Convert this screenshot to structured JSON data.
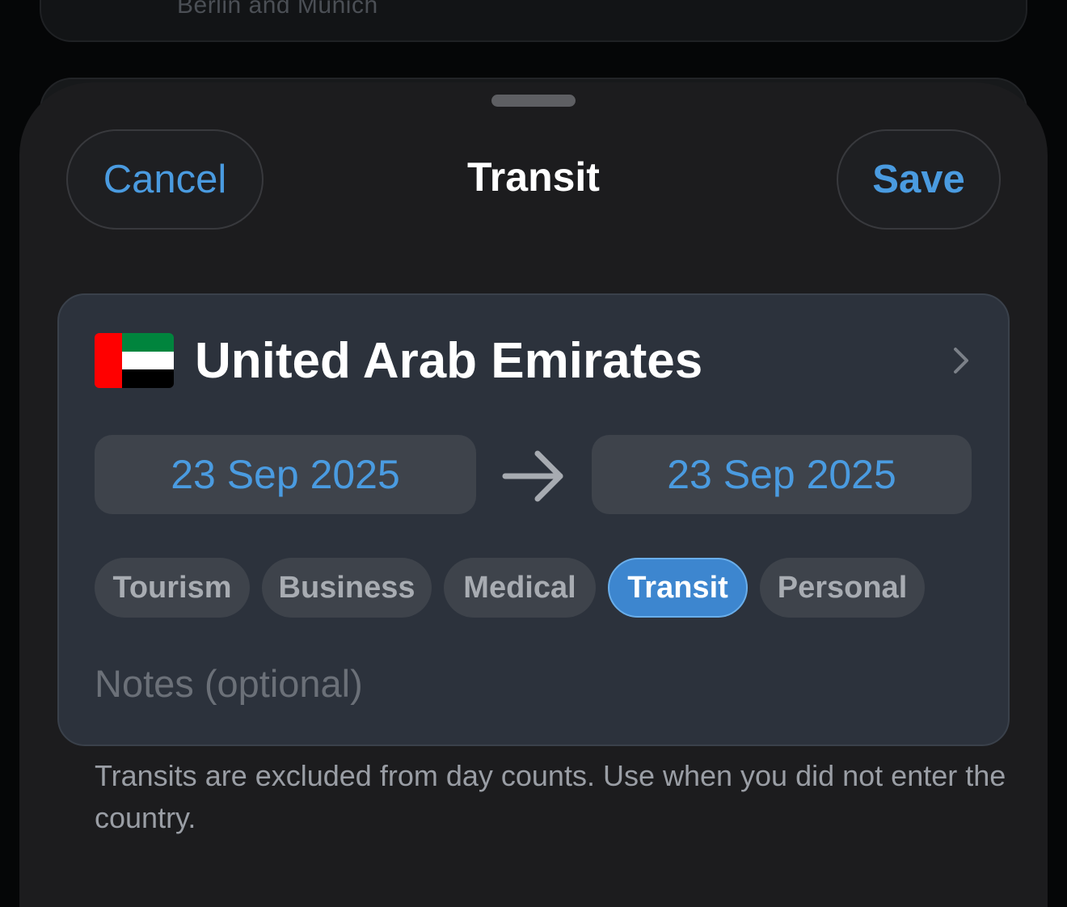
{
  "background": {
    "card_text": "Berlin and Munich"
  },
  "sheet": {
    "cancel_label": "Cancel",
    "title": "Transit",
    "save_label": "Save"
  },
  "entry": {
    "country_name": "United Arab Emirates",
    "flag_colors": [
      "#ff0000",
      "#00843d",
      "#ffffff",
      "#000000"
    ],
    "start_date": "23 Sep 2025",
    "end_date": "23 Sep 2025",
    "purposes": [
      {
        "label": "Tourism",
        "selected": false
      },
      {
        "label": "Business",
        "selected": false
      },
      {
        "label": "Medical",
        "selected": false
      },
      {
        "label": "Transit",
        "selected": true
      },
      {
        "label": "Personal",
        "selected": false
      }
    ],
    "notes_value": "",
    "notes_placeholder": "Notes (optional)"
  },
  "footnote": "Transits are excluded from day counts. Use when you did not enter the country.",
  "colors": {
    "accent": "#4a9be0",
    "selected_chip": "#3d86cf",
    "sheet_bg": "#1c1c1e",
    "card_bg": "#2c323c"
  }
}
